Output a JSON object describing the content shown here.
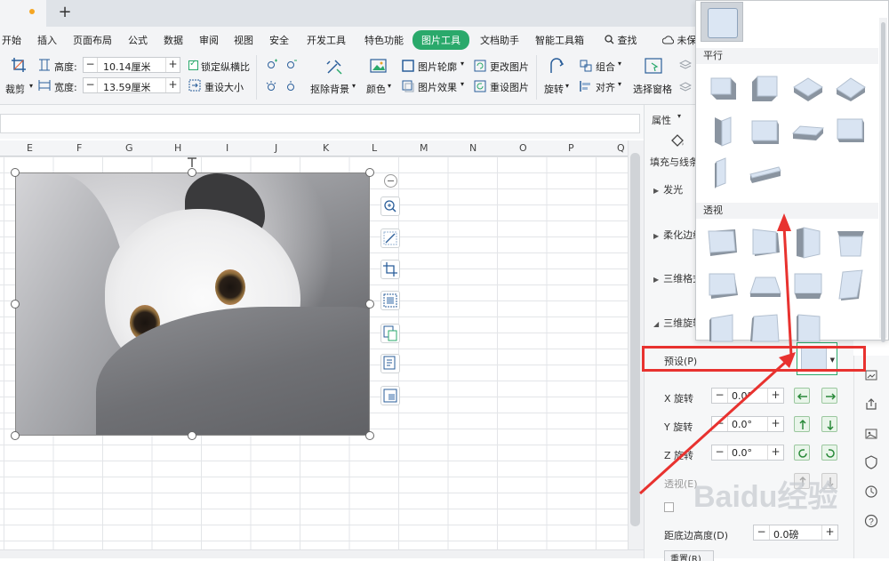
{
  "tab": {
    "new_tab": "+"
  },
  "menu": [
    {
      "label": "开始"
    },
    {
      "label": "插入"
    },
    {
      "label": "页面布局"
    },
    {
      "label": "公式"
    },
    {
      "label": "数据"
    },
    {
      "label": "审阅"
    },
    {
      "label": "视图"
    },
    {
      "label": "安全"
    },
    {
      "label": "开发工具"
    },
    {
      "label": "特色功能"
    },
    {
      "label": "图片工具",
      "active": true
    },
    {
      "label": "文档助手"
    },
    {
      "label": "智能工具箱"
    },
    {
      "label": "查找"
    },
    {
      "label": "未保"
    }
  ],
  "toolbar": {
    "crop": "裁剪",
    "height_label": "高度:",
    "height_value": "10.14厘米",
    "width_label": "宽度:",
    "width_value": "13.59厘米",
    "lock_ratio": "锁定纵横比",
    "reset_size": "重设大小",
    "remove_bg": "抠除背景",
    "color": "颜色",
    "outline": "图片轮廓",
    "effects": "图片效果",
    "change_picture": "更改图片",
    "reset_picture": "重设图片",
    "rotate": "旋转",
    "group": "组合",
    "align": "对齐",
    "selection_pane": "选择窗格"
  },
  "columns": [
    "E",
    "F",
    "G",
    "H",
    "I",
    "J",
    "K",
    "L",
    "M",
    "N",
    "O",
    "P",
    "Q"
  ],
  "pane": {
    "title": "属性",
    "fill_line": "填充与线条",
    "glow": "发光",
    "soft_edge": "柔化边缘",
    "format_3d": "三维格式",
    "rotation_3d": "三维旋转",
    "preset_label": "预设(P)",
    "x_rot_label": "X 旋转",
    "y_rot_label": "Y 旋转",
    "z_rot_label": "Z 旋转",
    "x_rot_value": "0.0°",
    "y_rot_value": "0.0°",
    "z_rot_value": "0.0°",
    "perspective_label": "透视(E)",
    "distance_label": "距底边高度(D)",
    "distance_value": "0.0磅",
    "reset_label": "重置(R)"
  },
  "dropdown": {
    "parallel_title": "平行",
    "perspective_title": "透视"
  },
  "colors": {
    "accent": "#2aa96b",
    "annotation": "#e8322f",
    "shape_face": "#d9e4f2",
    "shape_side": "#8a94a0"
  },
  "watermark": {
    "text": "Baidu经验"
  }
}
